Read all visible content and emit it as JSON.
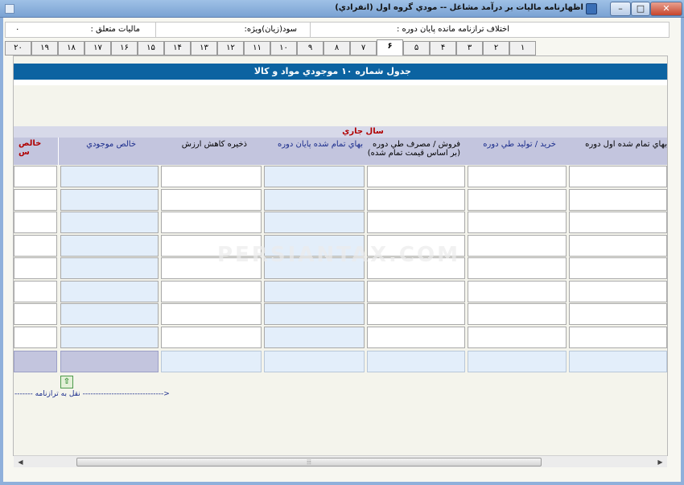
{
  "window": {
    "title": "اظهارنامه ماليات بر درآمد مشاغل -- مودي گروه اول (انفرادي)",
    "minimize_glyph": "–",
    "maximize_glyph": "□",
    "close_glyph": "✕"
  },
  "info_bar": {
    "balance_diff_label": "اختلاف ترازنامه مانده پايان دوره :",
    "profit_label": "سود(زيان)ويژه:",
    "tax_label": "ماليات متعلق :",
    "tax_value": "۰"
  },
  "tabs": [
    "۱",
    "۲",
    "۳",
    "۴",
    "۵",
    "۶",
    "۷",
    "۸",
    "۹",
    "۱۰",
    "۱۱",
    "۱۲",
    "۱۳",
    "۱۴",
    "۱۵",
    "۱۶",
    "۱۷",
    "۱۸",
    "۱۹",
    "۲۰"
  ],
  "active_tab": "۶",
  "table": {
    "title": "جدول شماره ۱۰ موجودي مواد و کالا",
    "group_header": "سال جاري",
    "left_header_top": "خالص",
    "left_header_bottom": "س",
    "columns": [
      "بهاي تمام شده اول دوره",
      "خريد / توليد طي دوره",
      "فروش / مصرف طي دوره",
      "(بر اساس قيمت تمام شده)",
      "بهاي تمام شده پايان دوره",
      "ذخيره کاهش ارزش",
      "خالص موجودي"
    ]
  },
  "watermark": "PERSIANTAX.COM",
  "nav": {
    "transfer_text": "------- نقل به ترازنامه ------------------------------->",
    "up_arrow_glyph": "⇧"
  },
  "scrollbar": {
    "left_glyph": "◀",
    "right_glyph": "▶",
    "grip_glyph": "⦙⦙⦙"
  }
}
